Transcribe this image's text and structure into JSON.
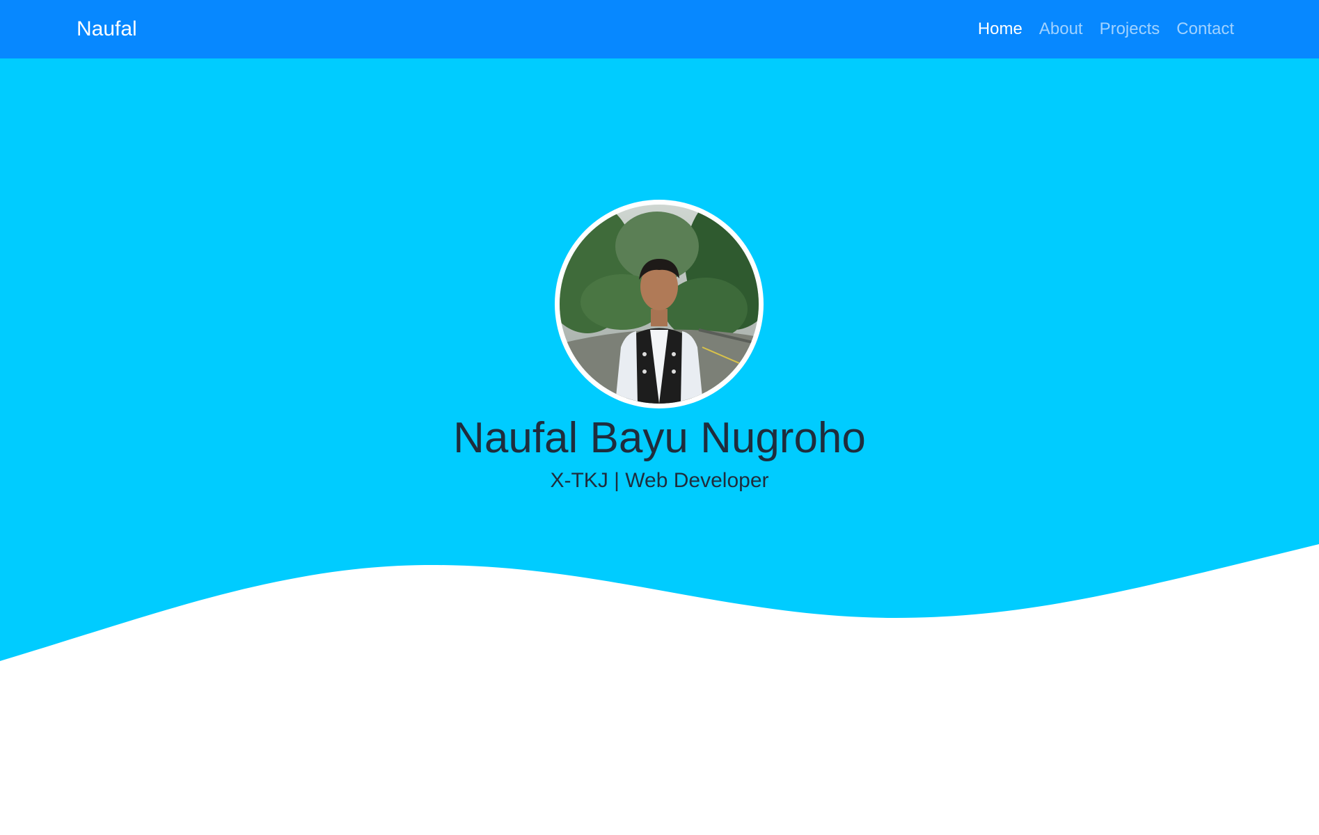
{
  "navbar": {
    "brand": "Naufal",
    "links": [
      {
        "label": "Home",
        "active": true
      },
      {
        "label": "About",
        "active": false
      },
      {
        "label": "Projects",
        "active": false
      },
      {
        "label": "Contact",
        "active": false
      }
    ]
  },
  "hero": {
    "name": "Naufal Bayu Nugroho",
    "subtitle": "X-TKJ | Web Developer",
    "avatar_alt": "profile-photo"
  },
  "colors": {
    "navbar": "#0788ff",
    "hero": "#00ccff",
    "text": "#1f2d3d"
  }
}
